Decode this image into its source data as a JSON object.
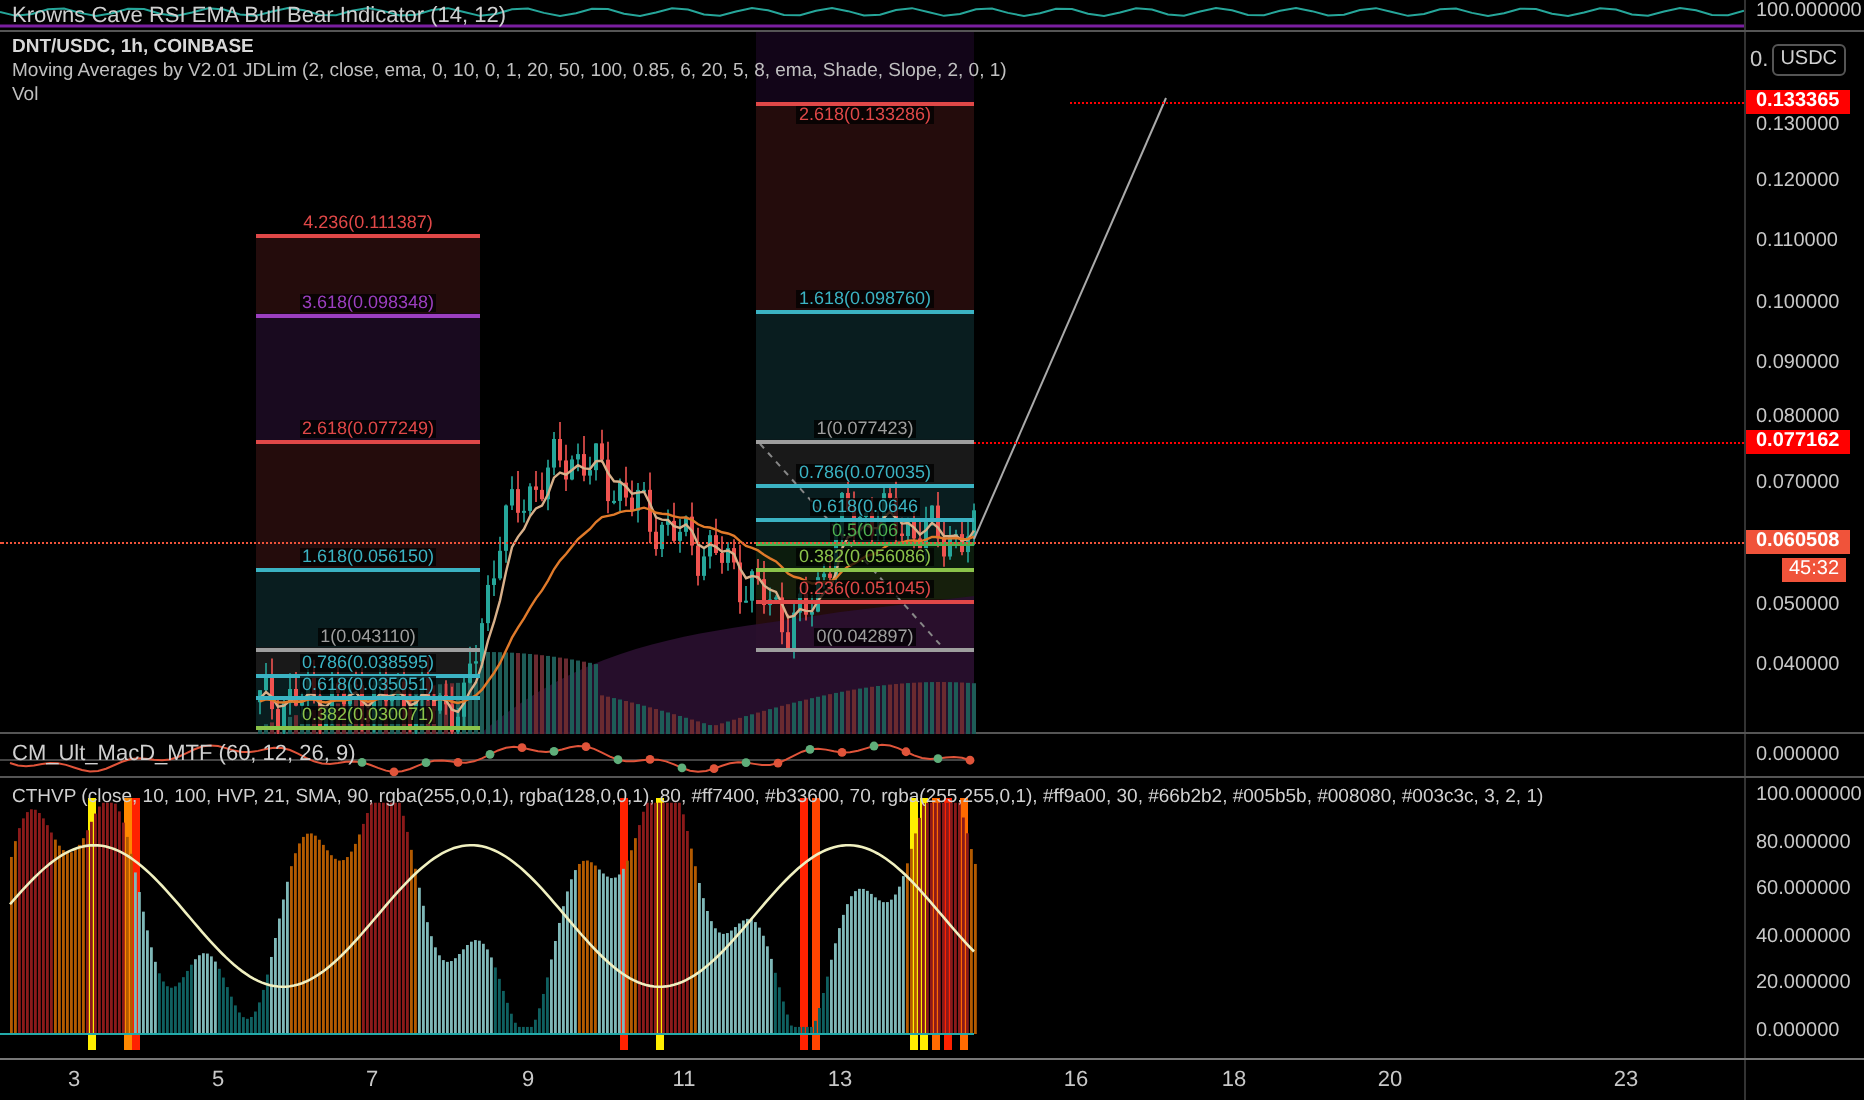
{
  "top_pane": {
    "legend": "Krowns Cave RSI EMA Bull Bear Indicator (14, 12)",
    "axis_label": "100.000000"
  },
  "main_pane": {
    "symbol": "DNT/USDC, 1h, COINBASE",
    "indicators": [
      "Moving Averages by V2.01 JDLim (2, close, ema, 0, 10, 0, 1, 20, 50, 100, 0.85, 6, 20, 5, 8, ema, Shade, Slope, 2, 0, 1)",
      "Vol"
    ],
    "fib_left": [
      {
        "label": "4.236(0.111387)",
        "color": "#e04848"
      },
      {
        "label": "3.618(0.098348)",
        "color": "#9c3fc0"
      },
      {
        "label": "2.618(0.077249)",
        "color": "#e04848"
      },
      {
        "label": "1.618(0.056150)",
        "color": "#3bb3c3"
      },
      {
        "label": "1(0.043110)",
        "color": "#9e9e9e"
      },
      {
        "label": "0.786(0.038595)",
        "color": "#3bb3c3"
      },
      {
        "label": "0.618(0.035051)",
        "color": "#3bb3c3"
      },
      {
        "label": "0.382(0.030071)",
        "color": "#8bc34a"
      }
    ],
    "fib_right": [
      {
        "label": "2.618(0.133286)",
        "color": "#e04848"
      },
      {
        "label": "1.618(0.098760)",
        "color": "#3bb3c3"
      },
      {
        "label": "1(0.077423)",
        "color": "#9e9e9e"
      },
      {
        "label": "0.786(0.070035)",
        "color": "#3bb3c3"
      },
      {
        "label": "0.618(0.0646",
        "color": "#3bb3c3"
      },
      {
        "label": "0.5(0.06",
        "color": "#4caf50"
      },
      {
        "label": "0.382(0.056086)",
        "color": "#8bc34a"
      },
      {
        "label": "0.236(0.051045)",
        "color": "#e04848"
      },
      {
        "label": "0(0.042897)",
        "color": "#9e9e9e"
      }
    ],
    "price_axis": {
      "currency": "USDC",
      "partial_tick": "0.",
      "ticks": [
        "0.130000",
        "0.120000",
        "0.110000",
        "0.100000",
        "0.090000",
        "0.080000",
        "0.070000",
        "0.050000",
        "0.040000"
      ]
    },
    "price_markers": [
      {
        "label": "0.133365",
        "color": "#ff0000"
      },
      {
        "label": "0.077162",
        "color": "#ff0000"
      },
      {
        "label": "0.060508",
        "color": "#f0533a",
        "countdown": "45:32"
      }
    ]
  },
  "macd_pane": {
    "legend": "CM_Ult_MacD_MTF (60, 12, 26, 9)",
    "axis_label": "0.000000"
  },
  "hvp_pane": {
    "legend": "CTHVP (close, 10, 100, HVP, 21, SMA, 90, rgba(255,0,0,1), rgba(128,0,0,1), 80, #ff7400, #b33600, 70, rgba(255,255,0,1), #ff9a00, 30, #66b2b2, #005b5b, #008080, #003c3c, 3, 2, 1)",
    "ticks": [
      "100.000000",
      "80.000000",
      "60.000000",
      "40.000000",
      "20.000000",
      "0.000000"
    ]
  },
  "time_axis": [
    "3",
    "5",
    "7",
    "9",
    "11",
    "13",
    "16",
    "18",
    "20",
    "23"
  ]
}
